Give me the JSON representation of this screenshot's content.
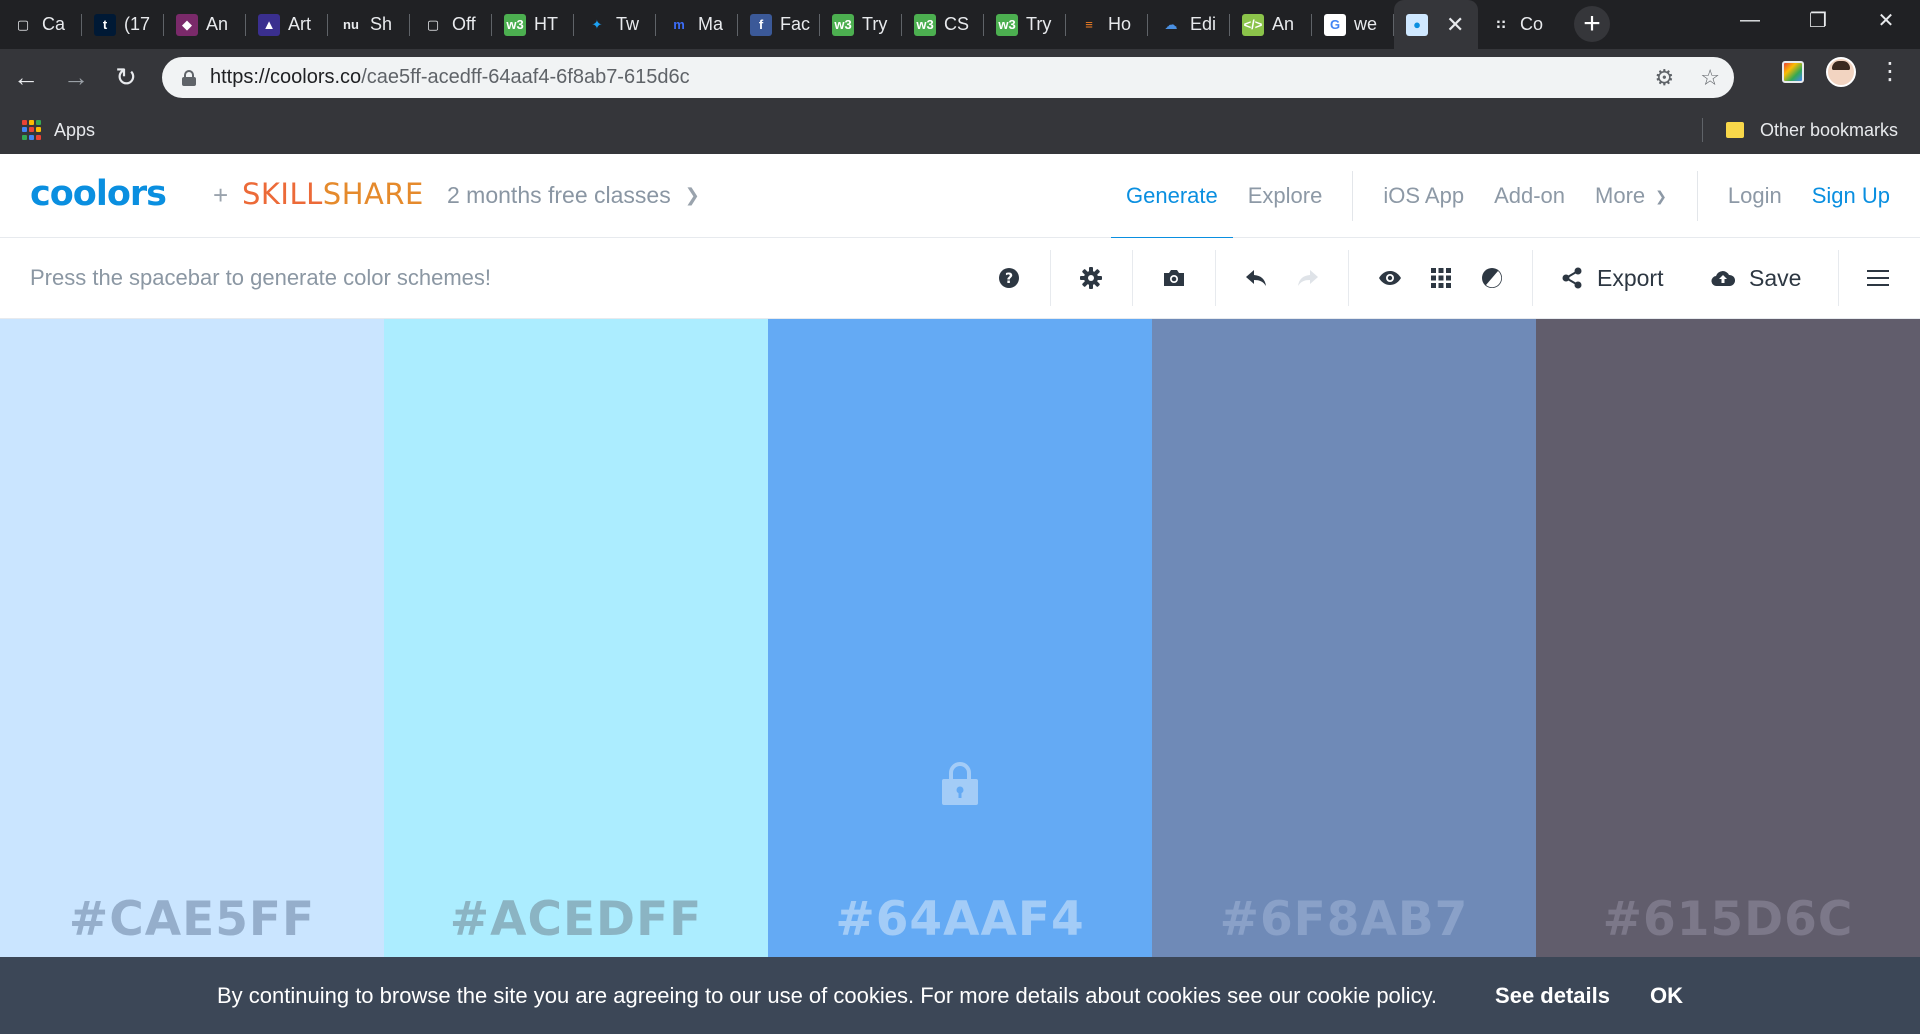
{
  "browser": {
    "tabs": [
      {
        "title": "Ca",
        "icon": "page-icon"
      },
      {
        "title": "(17",
        "icon": "tumblr-icon"
      },
      {
        "title": "An",
        "icon": "anime-icon"
      },
      {
        "title": "Art",
        "icon": "art-icon"
      },
      {
        "title": "Sh",
        "icon": "nu-icon"
      },
      {
        "title": "Off",
        "icon": "page-icon"
      },
      {
        "title": "HT",
        "icon": "w3schools-icon"
      },
      {
        "title": "Tw",
        "icon": "twitter-icon"
      },
      {
        "title": "Ma",
        "icon": "m-icon"
      },
      {
        "title": "Fac",
        "icon": "facebook-icon"
      },
      {
        "title": "Try",
        "icon": "w3schools-icon"
      },
      {
        "title": "CS",
        "icon": "w3schools-icon"
      },
      {
        "title": "Try",
        "icon": "w3schools-icon"
      },
      {
        "title": "Ho",
        "icon": "stackoverflow-icon"
      },
      {
        "title": "Edi",
        "icon": "cloud-icon"
      },
      {
        "title": "An",
        "icon": "code-icon"
      },
      {
        "title": "we",
        "icon": "google-icon"
      },
      {
        "title": "",
        "icon": "coolors-icon",
        "active": true
      },
      {
        "title": "Co",
        "icon": "dots-icon"
      }
    ],
    "url_host": "https://coolors.co",
    "url_path": "/cae5ff-acedff-64aaf4-6f8ab7-615d6c",
    "bookmarks": {
      "apps": "Apps",
      "other": "Other bookmarks"
    }
  },
  "header": {
    "logo": "coolors",
    "plus": "+",
    "partner_a": "SKILL",
    "partner_b": "SHARE",
    "promo": "2 months free classes",
    "nav": {
      "generate": "Generate",
      "explore": "Explore",
      "ios": "iOS App",
      "addon": "Add-on",
      "more": "More",
      "login": "Login",
      "signup": "Sign Up"
    }
  },
  "toolbar": {
    "hint": "Press the spacebar to generate color schemes!",
    "export": "Export",
    "save": "Save"
  },
  "palette": [
    {
      "hex": "#CAE5FF",
      "color": "#CAE5FF",
      "text_color": "#95AECB",
      "locked": false
    },
    {
      "hex": "#ACEDFF",
      "color": "#ACEDFF",
      "text_color": "#8BB4C3",
      "locked": false
    },
    {
      "hex": "#64AAF4",
      "color": "#64AAF4",
      "text_color": "#A3CCF7",
      "locked": true
    },
    {
      "hex": "#6F8AB7",
      "color": "#6F8AB7",
      "text_color": "#8AA1C8",
      "locked": false
    },
    {
      "hex": "#615D6C",
      "color": "#615D6C",
      "text_color": "#7C7889",
      "locked": false
    }
  ],
  "cookie": {
    "message": "By continuing to browse the site you are agreeing to our use of cookies. For more details about cookies see our cookie policy.",
    "details": "See details",
    "ok": "OK"
  }
}
